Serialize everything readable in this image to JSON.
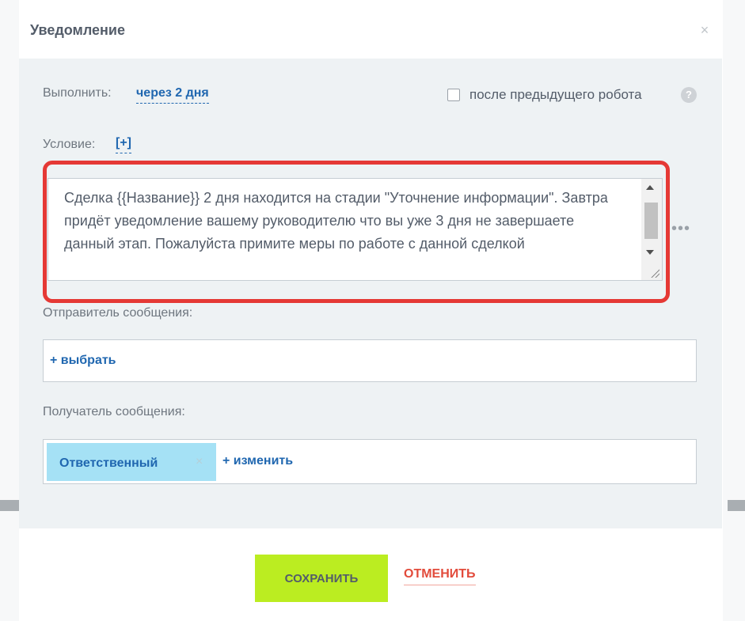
{
  "dialog": {
    "title": "Уведомление",
    "close_glyph": "×"
  },
  "execute": {
    "label": "Выполнить:",
    "value": "через 2 дня"
  },
  "after_prev": {
    "checked": false,
    "label": "после предыдущего робота",
    "help_glyph": "?"
  },
  "condition": {
    "label": "Условие:",
    "add": "[+]"
  },
  "message": {
    "text": "Сделка {{Название}} 2 дня находится на стадии \"Уточнение информации\". Завтра придёт уведомление вашему руководителю что вы уже 3 дня не завершаете данный этап. Пожалуйста примите меры по работе с данной сделкой"
  },
  "more_glyph": "•••",
  "sender": {
    "label": "Отправитель сообщения:",
    "choose": "+ выбрать"
  },
  "recipient": {
    "label": "Получатель сообщения:",
    "tag": "Ответственный",
    "tag_remove": "×",
    "change": "+ изменить"
  },
  "buttons": {
    "save": "СОХРАНИТЬ",
    "cancel": "ОТМЕНИТЬ"
  },
  "colors": {
    "accent_blue": "#2067b0",
    "save_green": "#bbed21",
    "cancel_red": "#e24b3b",
    "highlight_red": "#e53935",
    "panel_bg": "#eef2f4"
  }
}
